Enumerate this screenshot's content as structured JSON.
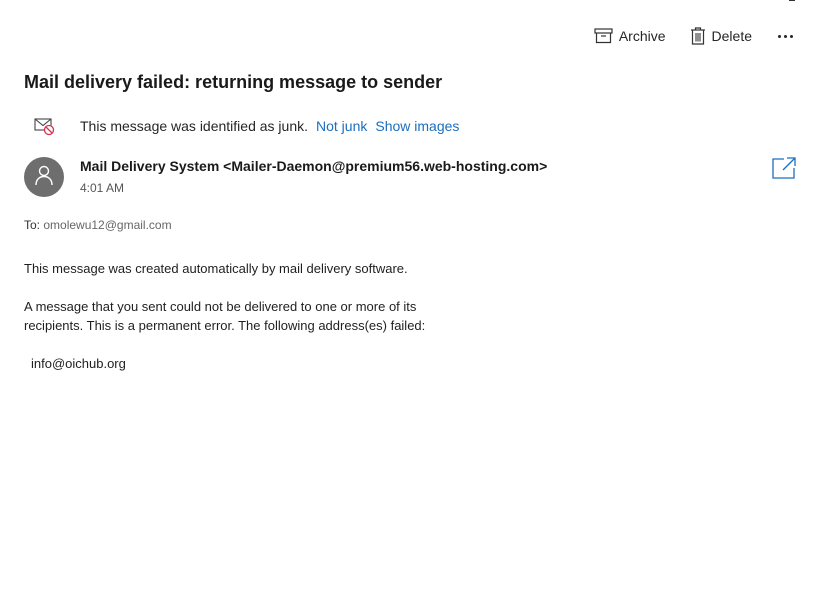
{
  "toolbar": {
    "archive_label": "Archive",
    "delete_label": "Delete",
    "more_label": "..."
  },
  "message": {
    "subject": "Mail delivery failed: returning message to sender",
    "junk_notice": "This message was identified as junk.",
    "not_junk_label": "Not junk",
    "show_images_label": "Show images",
    "sender": "Mail Delivery System <Mailer-Daemon@premium56.web-hosting.com>",
    "time": "4:01 AM",
    "to_label": "To:",
    "to_address": "omolewu12@gmail.com",
    "body_line1": "This message was created automatically by mail delivery software.",
    "body_line2a": "A message that you sent could not be delivered to one or more of its",
    "body_line2b": "recipients. This is a permanent error. The following address(es) failed:",
    "failed_address": "info@oichub.org"
  },
  "colors": {
    "link": "#1a6fc0",
    "avatar_bg": "#6e6e6e",
    "junk_icon_accent": "#d9344b"
  },
  "icons": {
    "archive": "archive-box-icon",
    "delete": "trash-icon",
    "more": "ellipsis-icon",
    "junk": "blocked-mail-icon",
    "avatar": "person-icon",
    "popout": "open-in-new-window-icon"
  }
}
